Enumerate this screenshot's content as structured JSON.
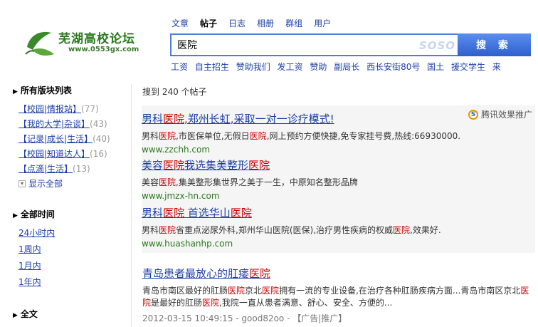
{
  "logo": {
    "title": "芜湖高校论坛",
    "url": "www.0553gx.com"
  },
  "tabs": [
    "文章",
    "帖子",
    "日志",
    "相册",
    "群组",
    "用户"
  ],
  "search": {
    "value": "医院",
    "brand": "SOSO",
    "button": "搜 索"
  },
  "hotwords": [
    "工资",
    "自主招生",
    "赞助我们",
    "发工资",
    "赞助",
    "副局长",
    "西长安街80号",
    "国土",
    "援交学生",
    "来"
  ],
  "sidebar": {
    "board_head": "所有版块列表",
    "boards": [
      {
        "label": "【校园|情报站】",
        "count": "(77)"
      },
      {
        "label": "【我的大学|杂谈】",
        "count": "(43)"
      },
      {
        "label": "【记录|成长|生活】",
        "count": "(40)"
      },
      {
        "label": "【校园|知道达人】",
        "count": "(16)"
      },
      {
        "label": "【点滴|生活】",
        "count": "(13)"
      }
    ],
    "show_all": "显示全部",
    "time_head": "全部时间",
    "times": [
      "24小时内",
      "1周内",
      "1月内",
      "1年内"
    ],
    "text_head": "全文"
  },
  "main": {
    "count_prefix": "搜到 240 个帖子",
    "ad_badge": "腾讯效果推广",
    "ads": [
      {
        "title_a": "男科",
        "title_em": "医院",
        "title_b": ",郑州长虹,采取一对一诊疗模式!",
        "desc_a": "男科",
        "desc_em1": "医院",
        "desc_b": ",市医保单位,无假日",
        "desc_em2": "医院",
        "desc_c": ",网上预约方便快捷,免专家挂号费,热线:66930000.",
        "url": "www.zzchh.com"
      },
      {
        "title_a": "美容",
        "title_em": "医院",
        "title_b": "我选集美整形",
        "title_em2": "医院",
        "desc_a": "美容",
        "desc_em1": "医院",
        "desc_b": ",集美整形集世界之美于一生，中原知名整形品牌",
        "url": "www.jmzx-hn.com"
      },
      {
        "title_a": "男科",
        "title_em": "医院",
        "title_b": " 首选华山",
        "title_em2": "医院",
        "desc_a": "男科",
        "desc_em1": "医院",
        "desc_b": "省重点泌尿外科,郑州华山医院(医保),治疗男性疾病的权威",
        "desc_em2": "医院",
        "desc_c": ",效果好.",
        "url": "www.huashanhp.com"
      }
    ],
    "result": {
      "title_a": "青岛患者最放心的肛瘘",
      "title_em": "医院",
      "desc_a": "青岛市南区最好的肛肠",
      "desc_em1": "医院",
      "desc_b": "京北",
      "desc_em2": "医院",
      "desc_c": "拥有一流的专业设备,在治疗各种肛肠疾病方面...青岛市南区京北",
      "desc_em3": "医",
      "desc_em4": "院",
      "desc_d": "是最好的肛肠",
      "desc_em5": "医院",
      "desc_e": ",我院一直从患者满意、舒心、安全、方便的...",
      "meta": "2012-03-15 10:49:15 - good82oo - 【广告|推广】"
    }
  }
}
